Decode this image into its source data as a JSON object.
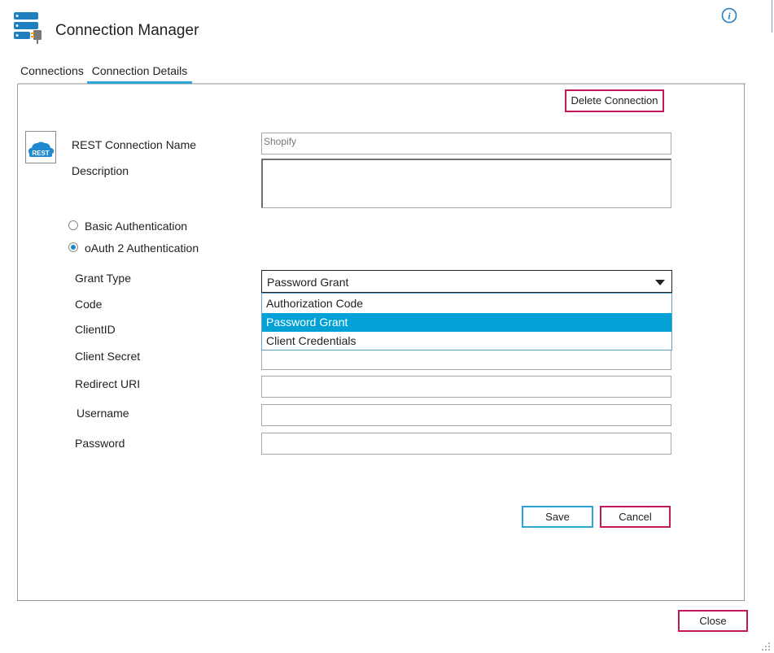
{
  "window": {
    "title": "Connection Manager",
    "icon": "server-plug-icon",
    "info_icon": "info-icon"
  },
  "tabs": [
    {
      "label": "Connections",
      "active": false
    },
    {
      "label": "Connection Details",
      "active": true
    }
  ],
  "actions": {
    "delete_label": "Delete Connection",
    "save_label": "Save",
    "cancel_label": "Cancel",
    "close_label": "Close"
  },
  "form": {
    "rest_icon_text": "REST",
    "name_label": "REST Connection Name",
    "name_value": "Shopify",
    "description_label": "Description",
    "description_value": "",
    "auth_options": [
      {
        "label": "Basic Authentication",
        "selected": false
      },
      {
        "label": "oAuth 2 Authentication",
        "selected": true
      }
    ],
    "grant_type_label": "Grant Type",
    "grant_type_value": "Password Grant",
    "grant_type_options": [
      "Authorization Code",
      "Password Grant",
      "Client Credentials"
    ],
    "code_label": "Code",
    "clientid_label": "ClientID",
    "client_secret_label": "Client Secret",
    "redirect_uri_label": "Redirect URI",
    "username_label": "Username",
    "password_label": "Password"
  },
  "colors": {
    "accent_blue": "#29a3d8",
    "accent_red": "#c2185b",
    "highlight": "#02a2d6"
  }
}
